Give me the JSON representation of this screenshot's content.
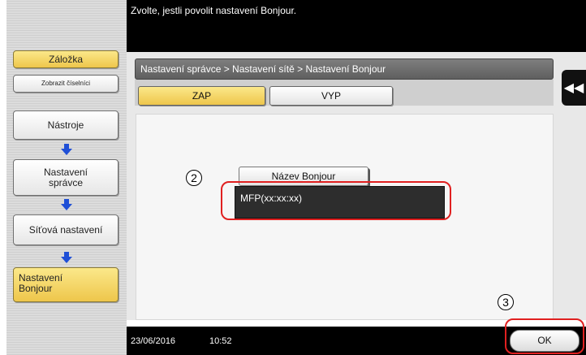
{
  "header": {
    "message": "Zvolte, jestli povolit nastavení Bonjour."
  },
  "sidebar": {
    "bookmark_label": "Záložka",
    "show_numeric_label": "Zobrazit číselníci",
    "steps": [
      {
        "label": "Nástroje"
      },
      {
        "label": "Nastavení\nsprávce"
      },
      {
        "label": "Síťová nastavení"
      },
      {
        "label": "Nastavení\nBonjour"
      }
    ]
  },
  "breadcrumb": "Nastavení správce > Nastavení sítě > Nastavení Bonjour",
  "tabs": {
    "on_label": "ZAP",
    "off_label": "VYP",
    "selected": "ZAP"
  },
  "bonjour": {
    "name_button_label": "Název Bonjour",
    "name_value": "MFP(xx:xx:xx)"
  },
  "callouts": {
    "name": "2",
    "ok": "3"
  },
  "footer": {
    "date": "23/06/2016",
    "time": "10:52",
    "ok_label": "OK"
  },
  "icons": {
    "collapse": "double-chevron-left-icon",
    "step_arrow": "arrow-down-icon"
  },
  "colors": {
    "selected": "#eec64b",
    "highlight": "#e02020",
    "header": "#000000"
  }
}
